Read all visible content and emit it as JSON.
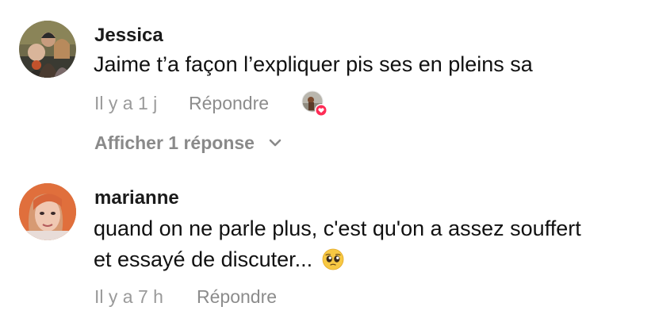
{
  "comments": [
    {
      "username": "Jessica",
      "text": "Jaime t’a façon l’expliquer pis ses en pleins sa",
      "time": "Il y a 1 j",
      "reply_label": "Répondre",
      "show_replies_label": "Afficher 1 réponse",
      "avatar_icon": "avatar-photo-icon",
      "liked_by_icon": "creator-liked-icon",
      "liked_badge_color": "#fe2c55"
    },
    {
      "username": "marianne",
      "text_line1": "quand on ne parle plus, c'est qu'on a assez souffert",
      "text_line2": "et essayé de discuter...",
      "emoji": "🥺",
      "time": "Il y a 7 h",
      "reply_label": "Répondre",
      "avatar_icon": "avatar-photo-icon"
    }
  ]
}
